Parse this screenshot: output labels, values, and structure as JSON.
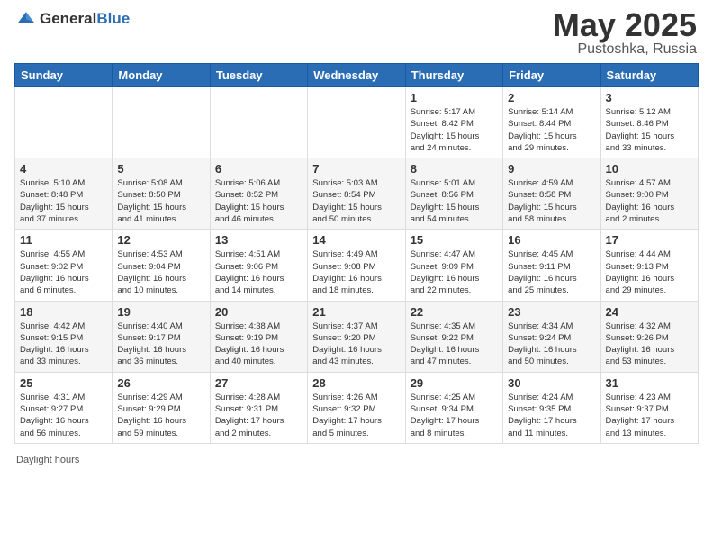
{
  "header": {
    "logo_general": "General",
    "logo_blue": "Blue",
    "title": "May 2025",
    "location": "Pustoshka, Russia"
  },
  "days_of_week": [
    "Sunday",
    "Monday",
    "Tuesday",
    "Wednesday",
    "Thursday",
    "Friday",
    "Saturday"
  ],
  "footer": {
    "daylight_label": "Daylight hours"
  },
  "weeks": [
    [
      {
        "num": "",
        "info": ""
      },
      {
        "num": "",
        "info": ""
      },
      {
        "num": "",
        "info": ""
      },
      {
        "num": "",
        "info": ""
      },
      {
        "num": "1",
        "info": "Sunrise: 5:17 AM\nSunset: 8:42 PM\nDaylight: 15 hours\nand 24 minutes."
      },
      {
        "num": "2",
        "info": "Sunrise: 5:14 AM\nSunset: 8:44 PM\nDaylight: 15 hours\nand 29 minutes."
      },
      {
        "num": "3",
        "info": "Sunrise: 5:12 AM\nSunset: 8:46 PM\nDaylight: 15 hours\nand 33 minutes."
      }
    ],
    [
      {
        "num": "4",
        "info": "Sunrise: 5:10 AM\nSunset: 8:48 PM\nDaylight: 15 hours\nand 37 minutes."
      },
      {
        "num": "5",
        "info": "Sunrise: 5:08 AM\nSunset: 8:50 PM\nDaylight: 15 hours\nand 41 minutes."
      },
      {
        "num": "6",
        "info": "Sunrise: 5:06 AM\nSunset: 8:52 PM\nDaylight: 15 hours\nand 46 minutes."
      },
      {
        "num": "7",
        "info": "Sunrise: 5:03 AM\nSunset: 8:54 PM\nDaylight: 15 hours\nand 50 minutes."
      },
      {
        "num": "8",
        "info": "Sunrise: 5:01 AM\nSunset: 8:56 PM\nDaylight: 15 hours\nand 54 minutes."
      },
      {
        "num": "9",
        "info": "Sunrise: 4:59 AM\nSunset: 8:58 PM\nDaylight: 15 hours\nand 58 minutes."
      },
      {
        "num": "10",
        "info": "Sunrise: 4:57 AM\nSunset: 9:00 PM\nDaylight: 16 hours\nand 2 minutes."
      }
    ],
    [
      {
        "num": "11",
        "info": "Sunrise: 4:55 AM\nSunset: 9:02 PM\nDaylight: 16 hours\nand 6 minutes."
      },
      {
        "num": "12",
        "info": "Sunrise: 4:53 AM\nSunset: 9:04 PM\nDaylight: 16 hours\nand 10 minutes."
      },
      {
        "num": "13",
        "info": "Sunrise: 4:51 AM\nSunset: 9:06 PM\nDaylight: 16 hours\nand 14 minutes."
      },
      {
        "num": "14",
        "info": "Sunrise: 4:49 AM\nSunset: 9:08 PM\nDaylight: 16 hours\nand 18 minutes."
      },
      {
        "num": "15",
        "info": "Sunrise: 4:47 AM\nSunset: 9:09 PM\nDaylight: 16 hours\nand 22 minutes."
      },
      {
        "num": "16",
        "info": "Sunrise: 4:45 AM\nSunset: 9:11 PM\nDaylight: 16 hours\nand 25 minutes."
      },
      {
        "num": "17",
        "info": "Sunrise: 4:44 AM\nSunset: 9:13 PM\nDaylight: 16 hours\nand 29 minutes."
      }
    ],
    [
      {
        "num": "18",
        "info": "Sunrise: 4:42 AM\nSunset: 9:15 PM\nDaylight: 16 hours\nand 33 minutes."
      },
      {
        "num": "19",
        "info": "Sunrise: 4:40 AM\nSunset: 9:17 PM\nDaylight: 16 hours\nand 36 minutes."
      },
      {
        "num": "20",
        "info": "Sunrise: 4:38 AM\nSunset: 9:19 PM\nDaylight: 16 hours\nand 40 minutes."
      },
      {
        "num": "21",
        "info": "Sunrise: 4:37 AM\nSunset: 9:20 PM\nDaylight: 16 hours\nand 43 minutes."
      },
      {
        "num": "22",
        "info": "Sunrise: 4:35 AM\nSunset: 9:22 PM\nDaylight: 16 hours\nand 47 minutes."
      },
      {
        "num": "23",
        "info": "Sunrise: 4:34 AM\nSunset: 9:24 PM\nDaylight: 16 hours\nand 50 minutes."
      },
      {
        "num": "24",
        "info": "Sunrise: 4:32 AM\nSunset: 9:26 PM\nDaylight: 16 hours\nand 53 minutes."
      }
    ],
    [
      {
        "num": "25",
        "info": "Sunrise: 4:31 AM\nSunset: 9:27 PM\nDaylight: 16 hours\nand 56 minutes."
      },
      {
        "num": "26",
        "info": "Sunrise: 4:29 AM\nSunset: 9:29 PM\nDaylight: 16 hours\nand 59 minutes."
      },
      {
        "num": "27",
        "info": "Sunrise: 4:28 AM\nSunset: 9:31 PM\nDaylight: 17 hours\nand 2 minutes."
      },
      {
        "num": "28",
        "info": "Sunrise: 4:26 AM\nSunset: 9:32 PM\nDaylight: 17 hours\nand 5 minutes."
      },
      {
        "num": "29",
        "info": "Sunrise: 4:25 AM\nSunset: 9:34 PM\nDaylight: 17 hours\nand 8 minutes."
      },
      {
        "num": "30",
        "info": "Sunrise: 4:24 AM\nSunset: 9:35 PM\nDaylight: 17 hours\nand 11 minutes."
      },
      {
        "num": "31",
        "info": "Sunrise: 4:23 AM\nSunset: 9:37 PM\nDaylight: 17 hours\nand 13 minutes."
      }
    ]
  ]
}
